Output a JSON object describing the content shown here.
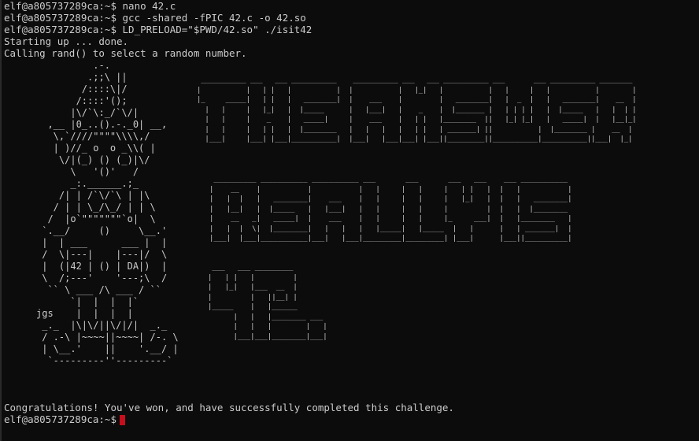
{
  "terminal": {
    "lines": [
      "elf@a805737289ca:~$ nano 42.c",
      "elf@a805737289ca:~$ gcc -shared -fPIC 42.c -o 42.so",
      "elf@a805737289ca:~$ LD_PRELOAD=\"$PWD/42.so\" ./isit42",
      "Starting up ... done.",
      "Calling rand() to select a random number."
    ],
    "elf_art": "          .-.\n         .;;\\ ||\n        /::::\\|/\n       /::::'();\n      |\\/`\\:_/`\\/|\n  ,__ |0_..().-._0| __,\n   \\,`////\"\"\"\"\\\\\\\\,/\n   | )//_ o  o _\\\\( |\n    \\/|(_) () (_)|\\/\n      \\   '()'   /\n      _:.______.;_\n    /| | /`\\/`\\ | |\\\n   / | | \\_/\\_/ | | \\\n  /  |o`\"\"\"\"\"\"\"`o|  \\\n `.__/     ()     \\__.'\n |  | ___      ___ |  |\n /  \\|---|    |---|/  \\\n |  (|42 | () | DA|)  |\n \\  /;---'    '---;\\  /\n  `` \\ ___ /\\ ___ / ``\n      `|  |  |  |`\njgs    |  |  |  |\n _._  |\\|\\/||\\/|/|  _._\n / .-\\ |~~~~||~~~~| /-. \\\n | \\__.'    ||    '.__/ |\n  `---------''---------`",
    "banner_line_1": " ___________ ___   ___ ___________    ___________ ___   ___ ___________ ___       ___ ___________ ________\n|           |   | |   |           |  |           |   |_|   |           |   |     |   |           |        |\n|_     _____|   | |   |   ________|  |    ___    |         |   ________|   |  _  |   |   ________|    __  |\n  |   |     |   |_|   |  |_____      |   |___|   |    _    |  |_______ |   | | | |   |  |_____   |   |  | |\n  |   |     |    _    |   _____|     |    ___    |   | |   |________  ||   |_| |_|   |   _____|  |   |__|_|\n  |   |     |   | |   |  |________   |   |   |   |   | |   | _______| ||           |  |________ |    __  |\n  |___|     |___| |___|___________|  |___|   |___|___| |___||_________||___________|___________||___|  |_|",
    "banner_line_2": " __________ ___________ ___________ ___       ___       ___   ___    ___ ___________\n|    __    |           |           |   |     |   |     |   | |   |  |   |           |\n|   |  |   |   ________|    ___    |   |     |   |     |   |_|   |  |   |   ________|\n|   |__|   |  |_____   |   |___|   |   |     |   |     |         |  |   |  |________\n|    __   _|   _____|  |    ___    |   |     |   |     |_     ___|  |   |________   |\n|   |  |  \\|  |________|   |   |   |   |_____|   |_____  |   |      |   | _______|  |\n|___|  |___|___________|___|   |___|_________|_________| |___|      |___||__________|",
    "banner_line_3": " ___   ___ _________\n|   | |   |         |\n|   |_|   |___  __  |\n|         |   ||__| |\n|_____    |   |______\n      |   |   |________ ___\n      |   |   |        |   |\n      |___|___|________|___|",
    "final_message": "Congratulations! You've won, and have successfully completed this challenge.",
    "prompt": "elf@a805737289ca:~$ "
  },
  "colors": {
    "background": "#0c0c0c",
    "foreground": "#cccccc",
    "cursor": "#c50f1f"
  }
}
